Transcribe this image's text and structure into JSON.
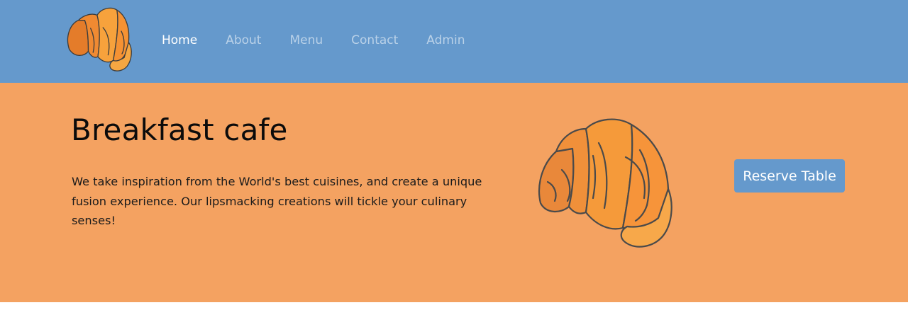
{
  "colors": {
    "navbar": "#6599cc",
    "hero": "#f4a261",
    "button": "#6599cc",
    "nav_active": "#ffffff",
    "nav_inactive": "#cfe0f0"
  },
  "navbar": {
    "logo_icon": "croissant-logo-icon",
    "links": [
      {
        "label": "Home",
        "active": true
      },
      {
        "label": "About",
        "active": false
      },
      {
        "label": "Menu",
        "active": false
      },
      {
        "label": "Contact",
        "active": false
      },
      {
        "label": "Admin",
        "active": false
      }
    ]
  },
  "hero": {
    "title": "Breakfast cafe",
    "description": "We take inspiration from the World's best cuisines, and create a unique fusion experience. Our lipsmacking creations will tickle your culinary senses!",
    "image_icon": "croissant-illustration-icon",
    "reserve_label": "Reserve Table"
  }
}
